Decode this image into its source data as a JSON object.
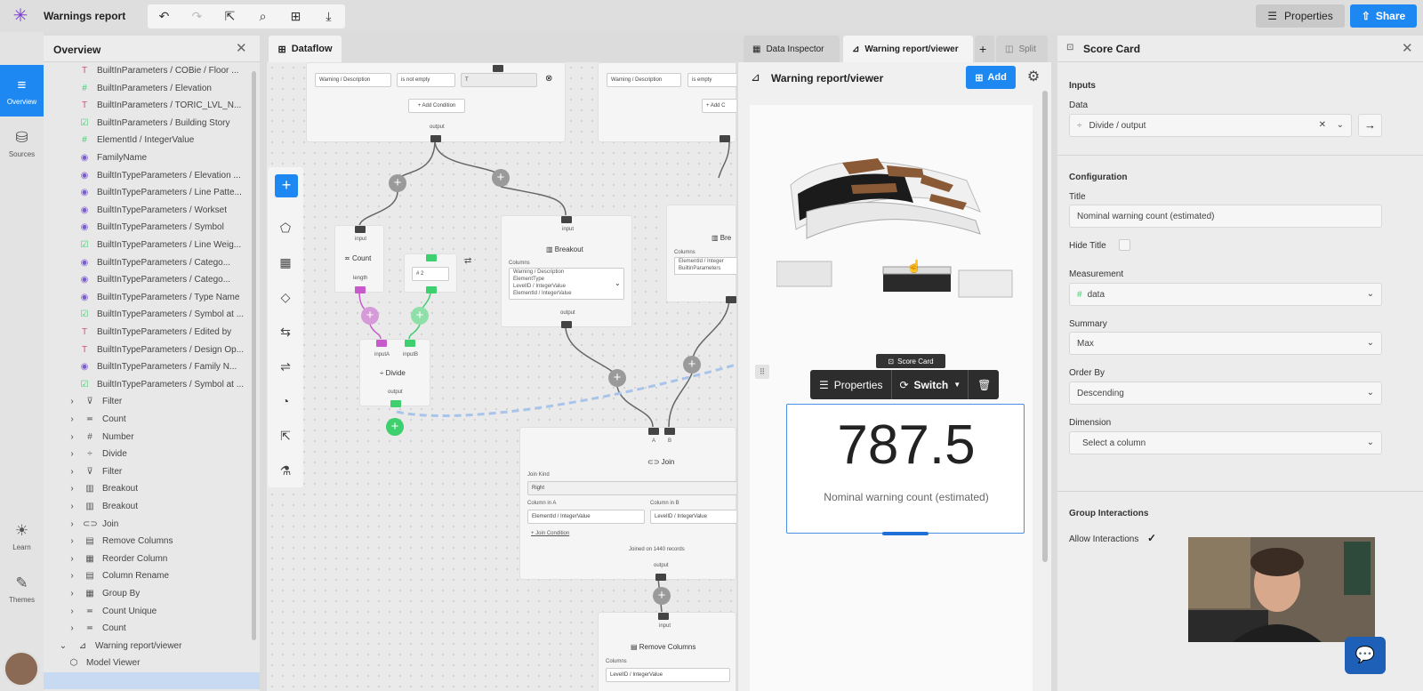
{
  "app": {
    "title": "Warnings report"
  },
  "topbar": {
    "properties_label": "Properties",
    "share_label": "Share"
  },
  "rail": [
    {
      "label": "Overview"
    },
    {
      "label": "Sources"
    },
    {
      "label": "Learn"
    },
    {
      "label": "Themes"
    }
  ],
  "overview": {
    "title": "Overview",
    "items": [
      {
        "icon": "T",
        "label": "BuiltInParameters / COBie / Floor ..."
      },
      {
        "icon": "#",
        "label": "BuiltInParameters / Elevation"
      },
      {
        "icon": "T",
        "label": "BuiltInParameters / TORIC_LVL_N..."
      },
      {
        "icon": "☑",
        "label": "BuiltInParameters / Building Story"
      },
      {
        "icon": "#",
        "label": "ElementId / IntegerValue"
      },
      {
        "icon": "◉",
        "label": "FamilyName"
      },
      {
        "icon": "◉",
        "label": "BuiltInTypeParameters / Elevation ..."
      },
      {
        "icon": "◉",
        "label": "BuiltInTypeParameters / Line Patte..."
      },
      {
        "icon": "◉",
        "label": "BuiltInTypeParameters / Workset"
      },
      {
        "icon": "◉",
        "label": "BuiltInTypeParameters / Symbol"
      },
      {
        "icon": "☑",
        "label": "BuiltInTypeParameters / Line Weig..."
      },
      {
        "icon": "◉",
        "label": "BuiltInTypeParameters / Catego..."
      },
      {
        "icon": "◉",
        "label": "BuiltInTypeParameters / Catego..."
      },
      {
        "icon": "◉",
        "label": "BuiltInTypeParameters / Type Name"
      },
      {
        "icon": "☑",
        "label": "BuiltInTypeParameters / Symbol at ..."
      },
      {
        "icon": "T",
        "label": "BuiltInTypeParameters / Edited by"
      },
      {
        "icon": "T",
        "label": "BuiltInTypeParameters / Design Op..."
      },
      {
        "icon": "◉",
        "label": "BuiltInTypeParameters / Family N..."
      },
      {
        "icon": "☑",
        "label": "BuiltInTypeParameters / Symbol at ..."
      }
    ],
    "nodes": [
      {
        "icon": "⊽",
        "label": "Filter"
      },
      {
        "icon": "≖",
        "label": "Count"
      },
      {
        "icon": "#",
        "label": "Number"
      },
      {
        "icon": "÷",
        "label": "Divide"
      },
      {
        "icon": "⊽",
        "label": "Filter"
      },
      {
        "icon": "▥",
        "label": "Breakout"
      },
      {
        "icon": "▥",
        "label": "Breakout"
      },
      {
        "icon": "⊂⊃",
        "label": "Join"
      },
      {
        "icon": "▤",
        "label": "Remove Columns"
      },
      {
        "icon": "▦",
        "label": "Reorder Column"
      },
      {
        "icon": "▤",
        "label": "Column Rename"
      },
      {
        "icon": "▦",
        "label": "Group By"
      },
      {
        "icon": "≖",
        "label": "Count Unique"
      },
      {
        "icon": "≖",
        "label": "Count"
      }
    ],
    "viewer": {
      "label": "Warning report/viewer"
    },
    "model_viewer": {
      "label": "Model Viewer"
    }
  },
  "dataflow": {
    "tab_label": "Dataflow",
    "filter1": {
      "col": "Warning / Description",
      "op": "is not empty",
      "add": "+ Add Condition",
      "out": "output"
    },
    "filter2": {
      "col": "Warning / Description",
      "op": "is empty",
      "add": "+ Add C"
    },
    "count": {
      "input": "input",
      "title": "Count",
      "out": "length"
    },
    "number": {
      "value": "2"
    },
    "divide": {
      "inA": "inputA",
      "inB": "inputB",
      "title": "Divide",
      "out": "output"
    },
    "breakout": {
      "input": "input",
      "title": "Breakout",
      "columns": "Columns",
      "cols": [
        "Warning / Description",
        "ElementType",
        "LevelID / IntegerValue",
        "ElementId / IntegerValue"
      ],
      "out": "output"
    },
    "breakout2": {
      "title": "Bre",
      "columns": "Columns",
      "cols": [
        "ElementId / Integer",
        "BuiltinParameters"
      ]
    },
    "join": {
      "a": "A",
      "b": "B",
      "title": "Join",
      "kind_label": "Join Kind",
      "kind": "Right",
      "colA_label": "Column in A",
      "colA": "ElementId / IntegerValue",
      "colB_label": "Column in B",
      "colB": "LevelID / IntegerValue",
      "cond": "Join Condition",
      "joined": "Joined on 1440 records",
      "out": "output"
    },
    "remove": {
      "input": "input",
      "title": "Remove Columns",
      "columns": "Columns",
      "col": "LevelID / IntegerValue"
    }
  },
  "tabs": {
    "inspector": "Data Inspector",
    "viewer": "Warning report/viewer",
    "split": "Split"
  },
  "viewer": {
    "title": "Warning report/viewer",
    "add_label": "Add",
    "card_badge": "Score Card",
    "toolbar": {
      "properties": "Properties",
      "switch": "Switch"
    },
    "score": {
      "value": "787.5",
      "title": "Nominal warning count (estimated)"
    }
  },
  "scorecard_panel": {
    "title": "Score Card",
    "inputs": "Inputs",
    "data_label": "Data",
    "data_value": "Divide / output",
    "configuration": "Configuration",
    "title_label": "Title",
    "title_value": "Nominal warning count (estimated)",
    "hide_title": "Hide Title",
    "measurement_label": "Measurement",
    "measurement_value": "data",
    "summary_label": "Summary",
    "summary_value": "Max",
    "order_label": "Order By",
    "order_value": "Descending",
    "dimension_label": "Dimension",
    "dimension_value": "Select a column",
    "group_label": "Group Interactions",
    "allow_label": "Allow Interactions"
  },
  "colors": {
    "accent": "#1e88f2",
    "count_port": "#c65bc9",
    "number_port": "#3ecf6e"
  }
}
